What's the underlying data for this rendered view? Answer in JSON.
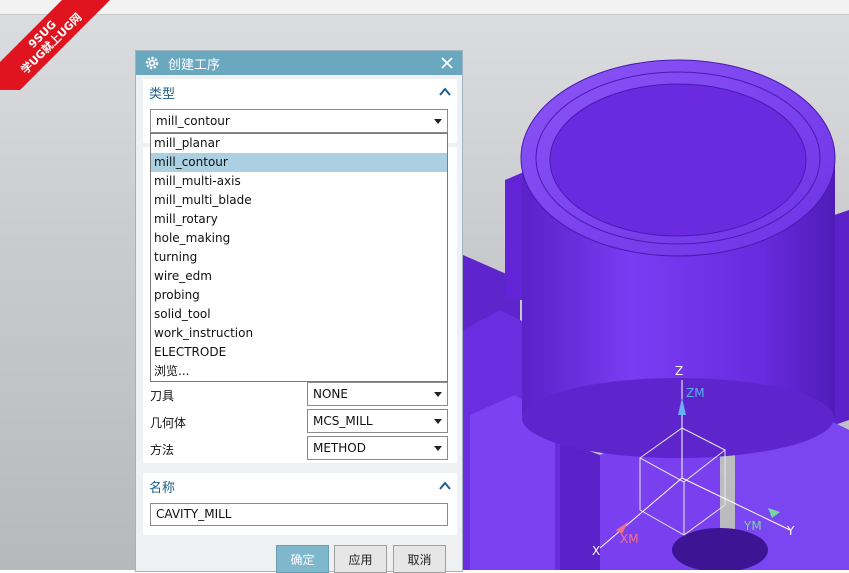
{
  "watermark": {
    "line1": "9SUG",
    "line2": "学UG就上UG网"
  },
  "dialog": {
    "title": "创建工序",
    "type_section": {
      "header": "类型",
      "selected": "mill_contour",
      "options": [
        "mill_planar",
        "mill_contour",
        "mill_multi-axis",
        "mill_multi_blade",
        "mill_rotary",
        "hole_making",
        "turning",
        "wire_edm",
        "probing",
        "solid_tool",
        "work_instruction",
        "ELECTRODE",
        "浏览..."
      ]
    },
    "location": {
      "tool_label": "刀具",
      "tool_value": "NONE",
      "geometry_label": "几何体",
      "geometry_value": "MCS_MILL",
      "method_label": "方法",
      "method_value": "METHOD"
    },
    "name_section": {
      "header": "名称",
      "value": "CAVITY_MILL"
    },
    "buttons": {
      "ok": "确定",
      "apply": "应用",
      "cancel": "取消"
    }
  },
  "axes": {
    "z": "Z",
    "zm": "ZM",
    "xm": "XM",
    "x": "X",
    "ym": "YM",
    "y": "Y"
  },
  "colors": {
    "title_bar": "#6aa8c0",
    "part": "#6a2be0",
    "selection": "#abd0e2",
    "accent_text": "#1f5f8c"
  }
}
